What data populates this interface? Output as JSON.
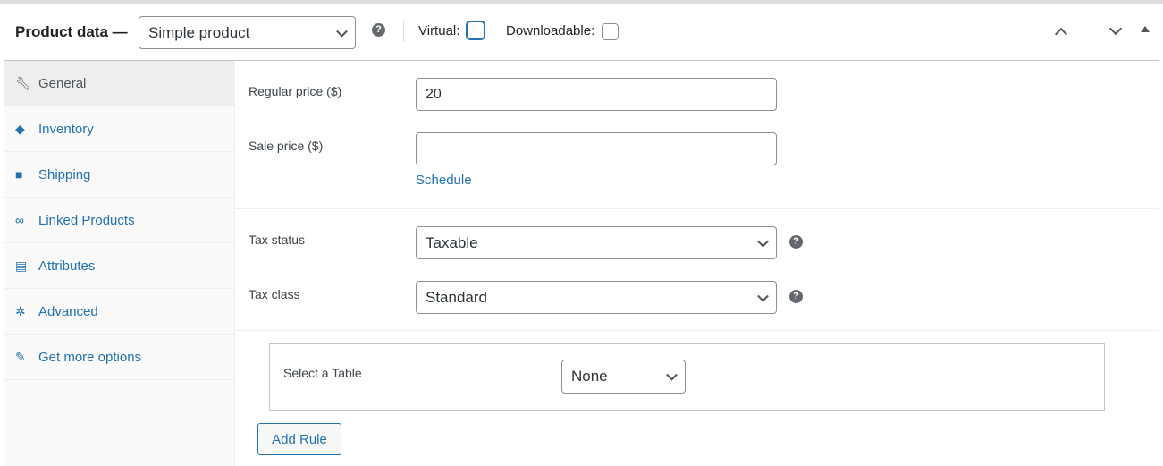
{
  "header": {
    "title": "Product data —",
    "product_type": "Simple product",
    "virtual_label": "Virtual:",
    "downloadable_label": "Downloadable:",
    "virtual_checked": false,
    "downloadable_checked": false
  },
  "sidebar": {
    "items": [
      {
        "label": "General",
        "icon": "wrench-icon"
      },
      {
        "label": "Inventory",
        "icon": "tag-icon"
      },
      {
        "label": "Shipping",
        "icon": "truck-icon"
      },
      {
        "label": "Linked Products",
        "icon": "link-icon"
      },
      {
        "label": "Attributes",
        "icon": "list-icon"
      },
      {
        "label": "Advanced",
        "icon": "gear-icon"
      },
      {
        "label": "Get more options",
        "icon": "plugin-icon"
      }
    ]
  },
  "general": {
    "regular_price_label": "Regular price ($)",
    "regular_price": "20",
    "sale_price_label": "Sale price ($)",
    "sale_price": "",
    "schedule_link": "Schedule",
    "tax_status_label": "Tax status",
    "tax_status": "Taxable",
    "tax_class_label": "Tax class",
    "tax_class": "Standard"
  },
  "table": {
    "label": "Select a Table",
    "value": "None",
    "add_rule": "Add Rule"
  },
  "help_glyph": "?"
}
